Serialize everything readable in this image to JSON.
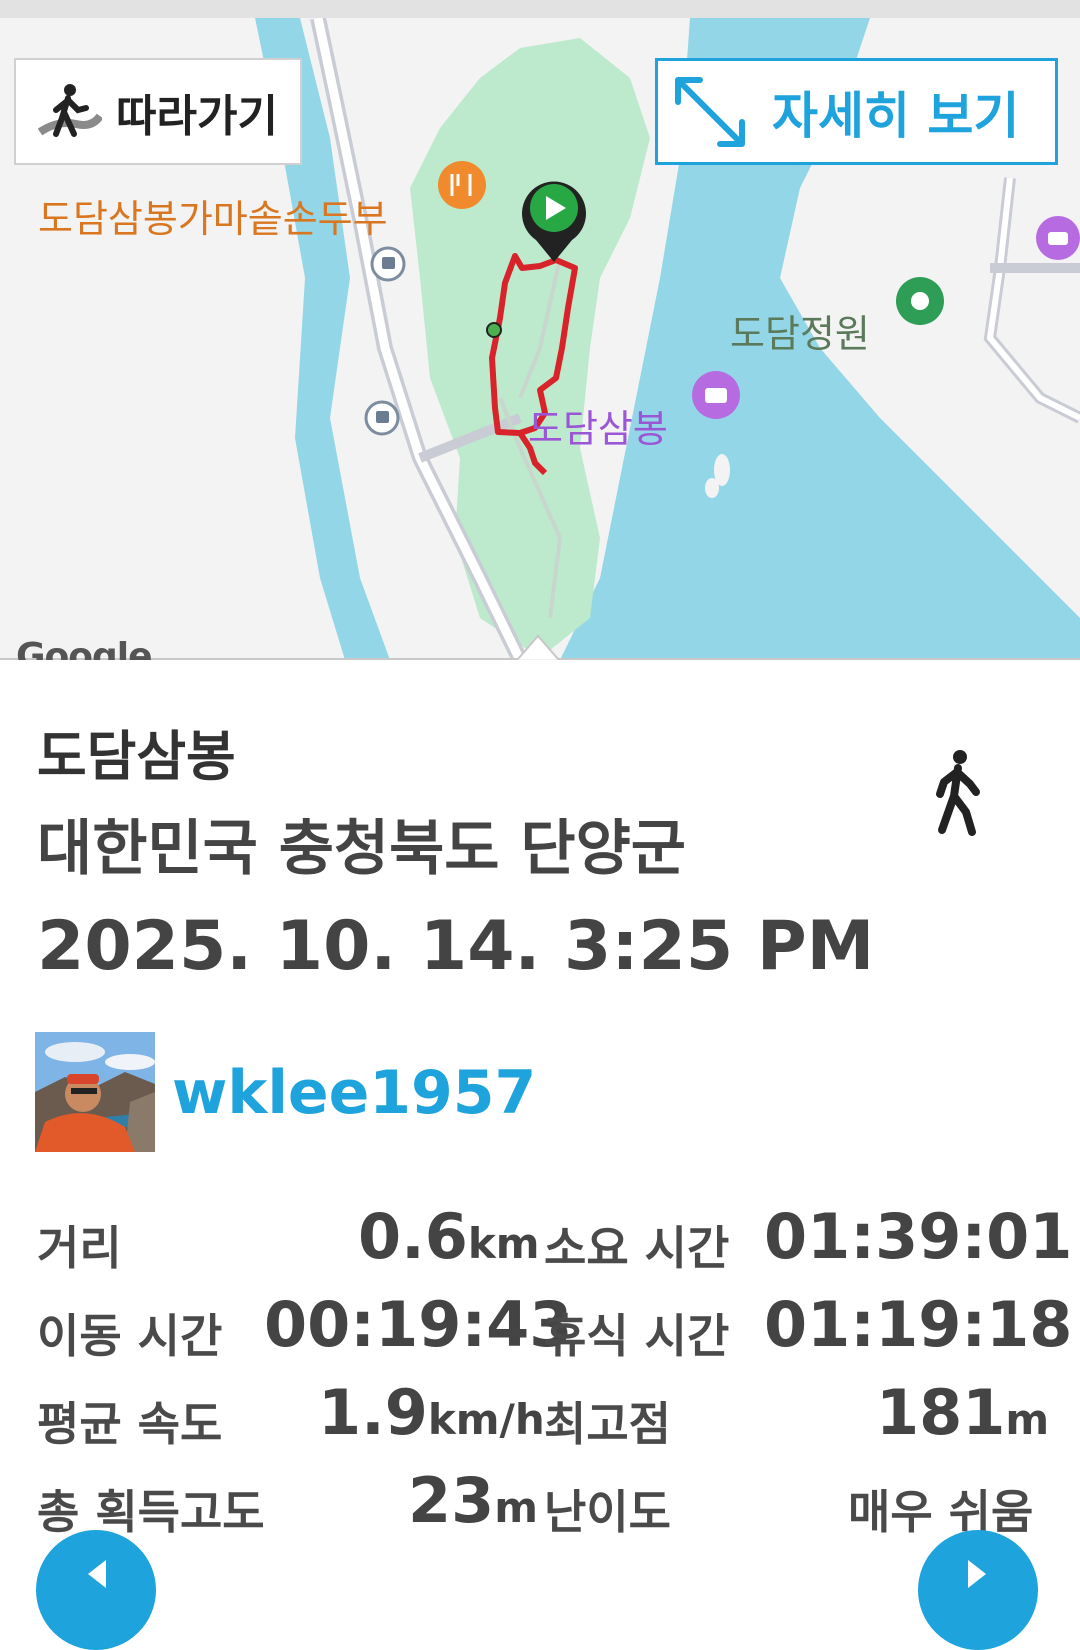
{
  "map": {
    "follow_button": "따라가기",
    "detail_button": "자세히 보기",
    "pois": {
      "restaurant": "도담삼봉가마솥손두부",
      "garden": "도담정원",
      "spot": "도담삼봉"
    },
    "attribution": "Google",
    "colors": {
      "water": "#93d6e8",
      "park": "#bde9cd",
      "route": "#d8232a",
      "accent": "#1ea3dc"
    }
  },
  "info": {
    "title": "도담삼봉",
    "region": "대한민국 충청북도 단양군",
    "datetime": "2025. 10. 14. 3:25 PM",
    "activity_icon": "walking-person-icon",
    "username": "wklee1957"
  },
  "stats": {
    "distance": {
      "label": "거리",
      "value": "0.6",
      "unit": "km"
    },
    "duration": {
      "label": "소요 시간",
      "value": "01:39:01"
    },
    "moving_time": {
      "label": "이동 시간",
      "value": "00:19:43"
    },
    "rest_time": {
      "label": "휴식 시간",
      "value": "01:19:18"
    },
    "avg_speed": {
      "label": "평균 속도",
      "value": "1.9",
      "unit": "km/h"
    },
    "max_elevation": {
      "label": "최고점",
      "value": "181",
      "unit": "m"
    },
    "total_ascent": {
      "label": "총 획득고도",
      "value": "23",
      "unit": "m"
    },
    "difficulty": {
      "label": "난이도",
      "value": "매우 쉬움"
    }
  }
}
